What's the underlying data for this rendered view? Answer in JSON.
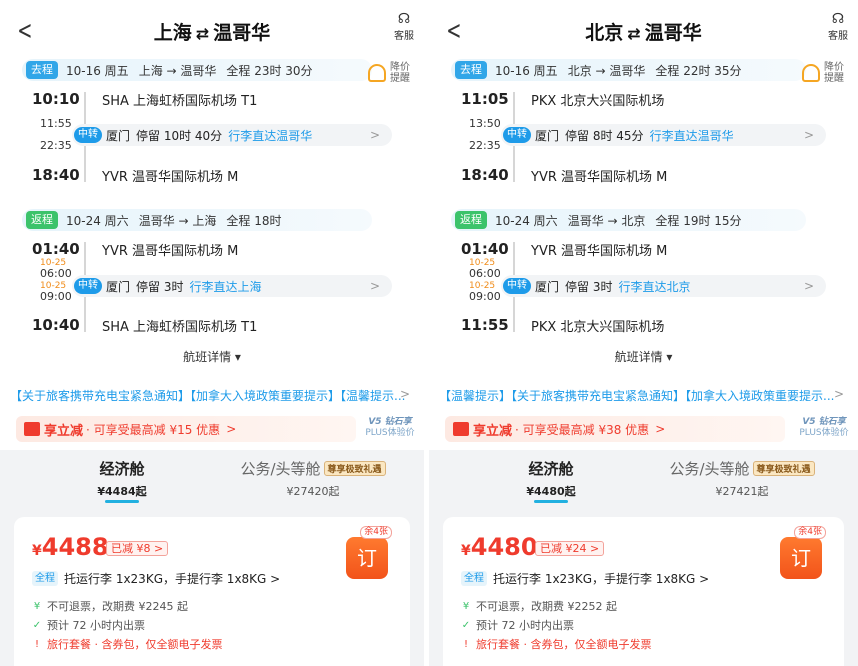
{
  "panels": [
    {
      "title_from": "上海",
      "title_swap": "⇄",
      "title_to": "温哥华",
      "service_label": "客服",
      "alert_label_1": "降价",
      "alert_label_2": "提醒",
      "outbound": {
        "tag": "去程",
        "date": "10-16 周五",
        "route": "上海 → 温哥华",
        "duration": "全程 23时 30分",
        "dep_time": "10:10",
        "dep_airport": "SHA 上海虹桥国际机场 T1",
        "stop_arr_time": "11:55",
        "stop_dep_time": "22:35",
        "stop_tag": "中转",
        "stop_city": "厦门",
        "stop_stay": "停留 10时 40分",
        "stop_baggage": "行李直达温哥华",
        "arr_time": "18:40",
        "arr_airport": "YVR 温哥华国际机场 M"
      },
      "return": {
        "tag": "返程",
        "date": "10-24 周六",
        "route": "温哥华 → 上海",
        "duration": "全程 18时",
        "dep_time": "01:40",
        "dep_airport": "YVR 温哥华国际机场 M",
        "stop_arr_date": "10-25",
        "stop_arr_time": "06:00",
        "stop_dep_date": "10-25",
        "stop_dep_time": "09:00",
        "stop_tag": "中转",
        "stop_city": "厦门",
        "stop_stay": "停留 3时",
        "stop_baggage": "行李直达上海",
        "arr_time": "10:40",
        "arr_airport": "SHA 上海虹桥国际机场 T1"
      },
      "details_label": "航班详情 ▾",
      "notice": "【关于旅客携带充电宝紧急通知】【加拿大入境政策重要提示】【温馨提示...",
      "promo_title": "享立减",
      "promo_desc": "· 可享受最高减 ¥15 优惠",
      "promo_chevron": ">",
      "plus_line1": "V5 钻石享",
      "plus_line2": "PLUS体验价",
      "tab_economy_name": "经济舱",
      "tab_economy_price": "¥4484起",
      "tab_business_name": "公务/头等舱",
      "tab_business_badge": "尊享极致礼遇",
      "tab_business_price": "¥27420起",
      "card_currency": "¥",
      "card_price": "4488",
      "card_discount": "已减 ¥8 >",
      "card_remaining": "余4张",
      "card_book": "订",
      "card_scope": "全程",
      "card_baggage": "托运行李 1x23KG，手提行李 1x8KG >",
      "rule_refund": "不可退票，改期费 ¥2245 起",
      "rule_ticket": "预计 72 小时内出票",
      "rule_package": "旅行套餐 · 含券包，仅全额电子发票"
    },
    {
      "title_from": "北京",
      "title_swap": "⇄",
      "title_to": "温哥华",
      "service_label": "客服",
      "alert_label_1": "降价",
      "alert_label_2": "提醒",
      "outbound": {
        "tag": "去程",
        "date": "10-16 周五",
        "route": "北京 → 温哥华",
        "duration": "全程 22时 35分",
        "dep_time": "11:05",
        "dep_airport": "PKX 北京大兴国际机场",
        "stop_arr_time": "13:50",
        "stop_dep_time": "22:35",
        "stop_tag": "中转",
        "stop_city": "厦门",
        "stop_stay": "停留 8时 45分",
        "stop_baggage": "行李直达温哥华",
        "arr_time": "18:40",
        "arr_airport": "YVR 温哥华国际机场 M"
      },
      "return": {
        "tag": "返程",
        "date": "10-24 周六",
        "route": "温哥华 → 北京",
        "duration": "全程 19时 15分",
        "dep_time": "01:40",
        "dep_airport": "YVR 温哥华国际机场 M",
        "stop_arr_date": "10-25",
        "stop_arr_time": "06:00",
        "stop_dep_date": "10-25",
        "stop_dep_time": "09:00",
        "stop_tag": "中转",
        "stop_city": "厦门",
        "stop_stay": "停留 3时",
        "stop_baggage": "行李直达北京",
        "arr_time": "11:55",
        "arr_airport": "PKX 北京大兴国际机场"
      },
      "details_label": "航班详情 ▾",
      "notice": "【温馨提示】【关于旅客携带充电宝紧急通知】【加拿大入境政策重要提示...",
      "promo_title": "享立减",
      "promo_desc": "· 可享受最高减 ¥38 优惠",
      "promo_chevron": ">",
      "plus_line1": "V5 钻石享",
      "plus_line2": "PLUS体验价",
      "tab_economy_name": "经济舱",
      "tab_economy_price": "¥4480起",
      "tab_business_name": "公务/头等舱",
      "tab_business_badge": "尊享极致礼遇",
      "tab_business_price": "¥27421起",
      "card_currency": "¥",
      "card_price": "4480",
      "card_discount": "已减 ¥24 >",
      "card_remaining": "余4张",
      "card_book": "订",
      "card_scope": "全程",
      "card_baggage": "托运行李 1x23KG，手提行李 1x8KG >",
      "rule_refund": "不可退票，改期费 ¥2252 起",
      "rule_ticket": "预计 72 小时内出票",
      "rule_package": "旅行套餐 · 含券包，仅全额电子发票"
    }
  ],
  "colors": {
    "outbound_tag": "#31a6e8",
    "return_tag": "#3cc36b",
    "accent_blue": "#1e9be9",
    "price_red": "#ef3b2d",
    "book_orange": "#f2531a"
  }
}
